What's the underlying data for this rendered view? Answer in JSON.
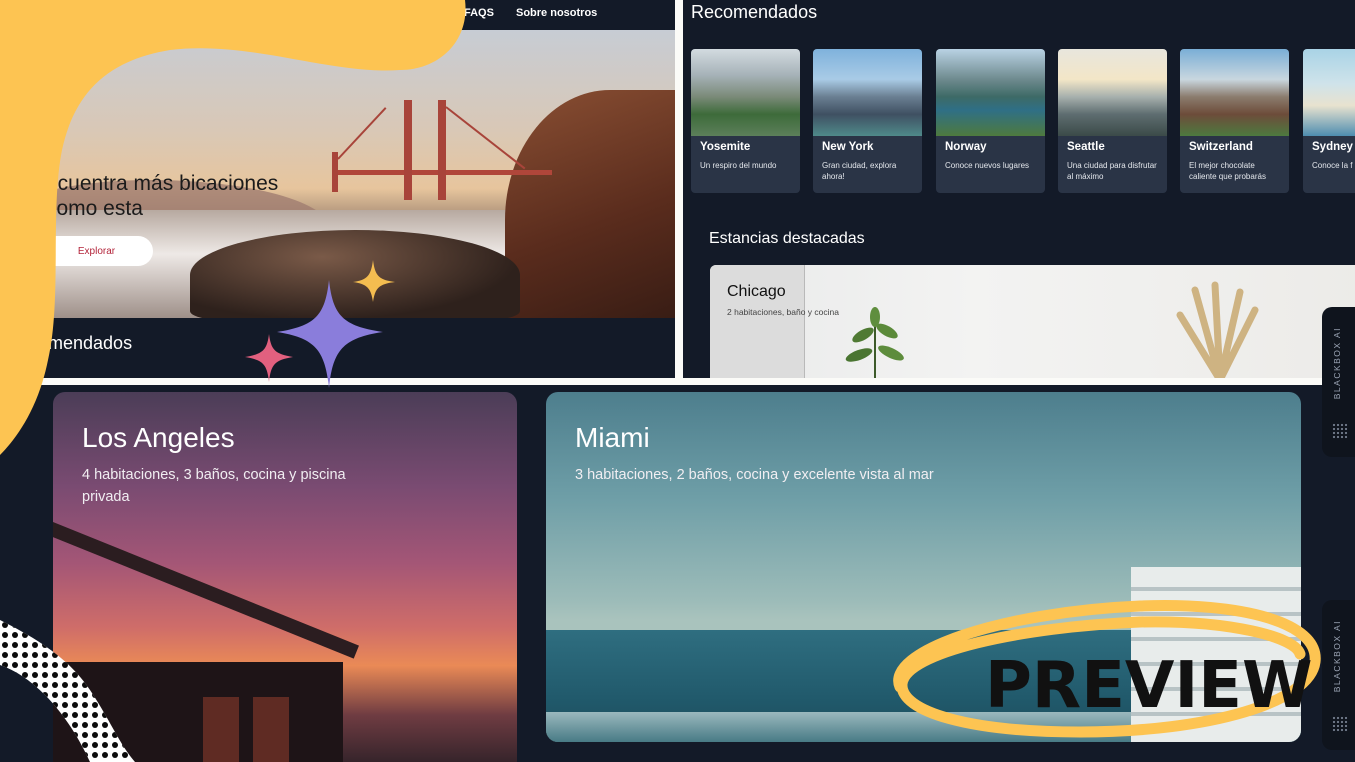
{
  "nav": {
    "faqs": "FAQS",
    "about": "Sobre nosotros"
  },
  "hero": {
    "title": "ncuentra más bicaciones como esta",
    "explore_button": "Explorar",
    "section_title": "omendados"
  },
  "recommended": {
    "title": "Recomendados",
    "cards": [
      {
        "name": "Yosemite",
        "desc": "Un respiro del mundo"
      },
      {
        "name": "New York",
        "desc": "Gran ciudad, explora ahora!"
      },
      {
        "name": "Norway",
        "desc": "Conoce nuevos lugares"
      },
      {
        "name": "Seattle",
        "desc": "Una ciudad para disfrutar al máximo"
      },
      {
        "name": "Switzerland",
        "desc": "El mejor chocolate caliente que probarás"
      },
      {
        "name": "Sydney",
        "desc": "Conoce la f Opera"
      }
    ]
  },
  "featured": {
    "title": "Estancias destacadas",
    "card": {
      "name": "Chicago",
      "desc": "2 habitaciones, baño y cocina"
    }
  },
  "stays": [
    {
      "name": "Los Angeles",
      "desc": "4 habitaciones, 3 baños, cocina y piscina privada"
    },
    {
      "name": "Miami",
      "desc": "3 habitaciones, 2 baños, cocina y excelente vista al mar"
    }
  ],
  "widgets": {
    "label_1": "BLACKBOX AI",
    "label_2": "BLACKBOX AI"
  },
  "overlay": {
    "stamp": "PREVIEW"
  },
  "colors": {
    "dark_bg": "#131a28",
    "card_bg": "#2a3446",
    "accent_red": "#b3243a",
    "deco_yellow": "#fdc452",
    "deco_purple": "#8a7ddb",
    "deco_pink": "#e2607f"
  }
}
